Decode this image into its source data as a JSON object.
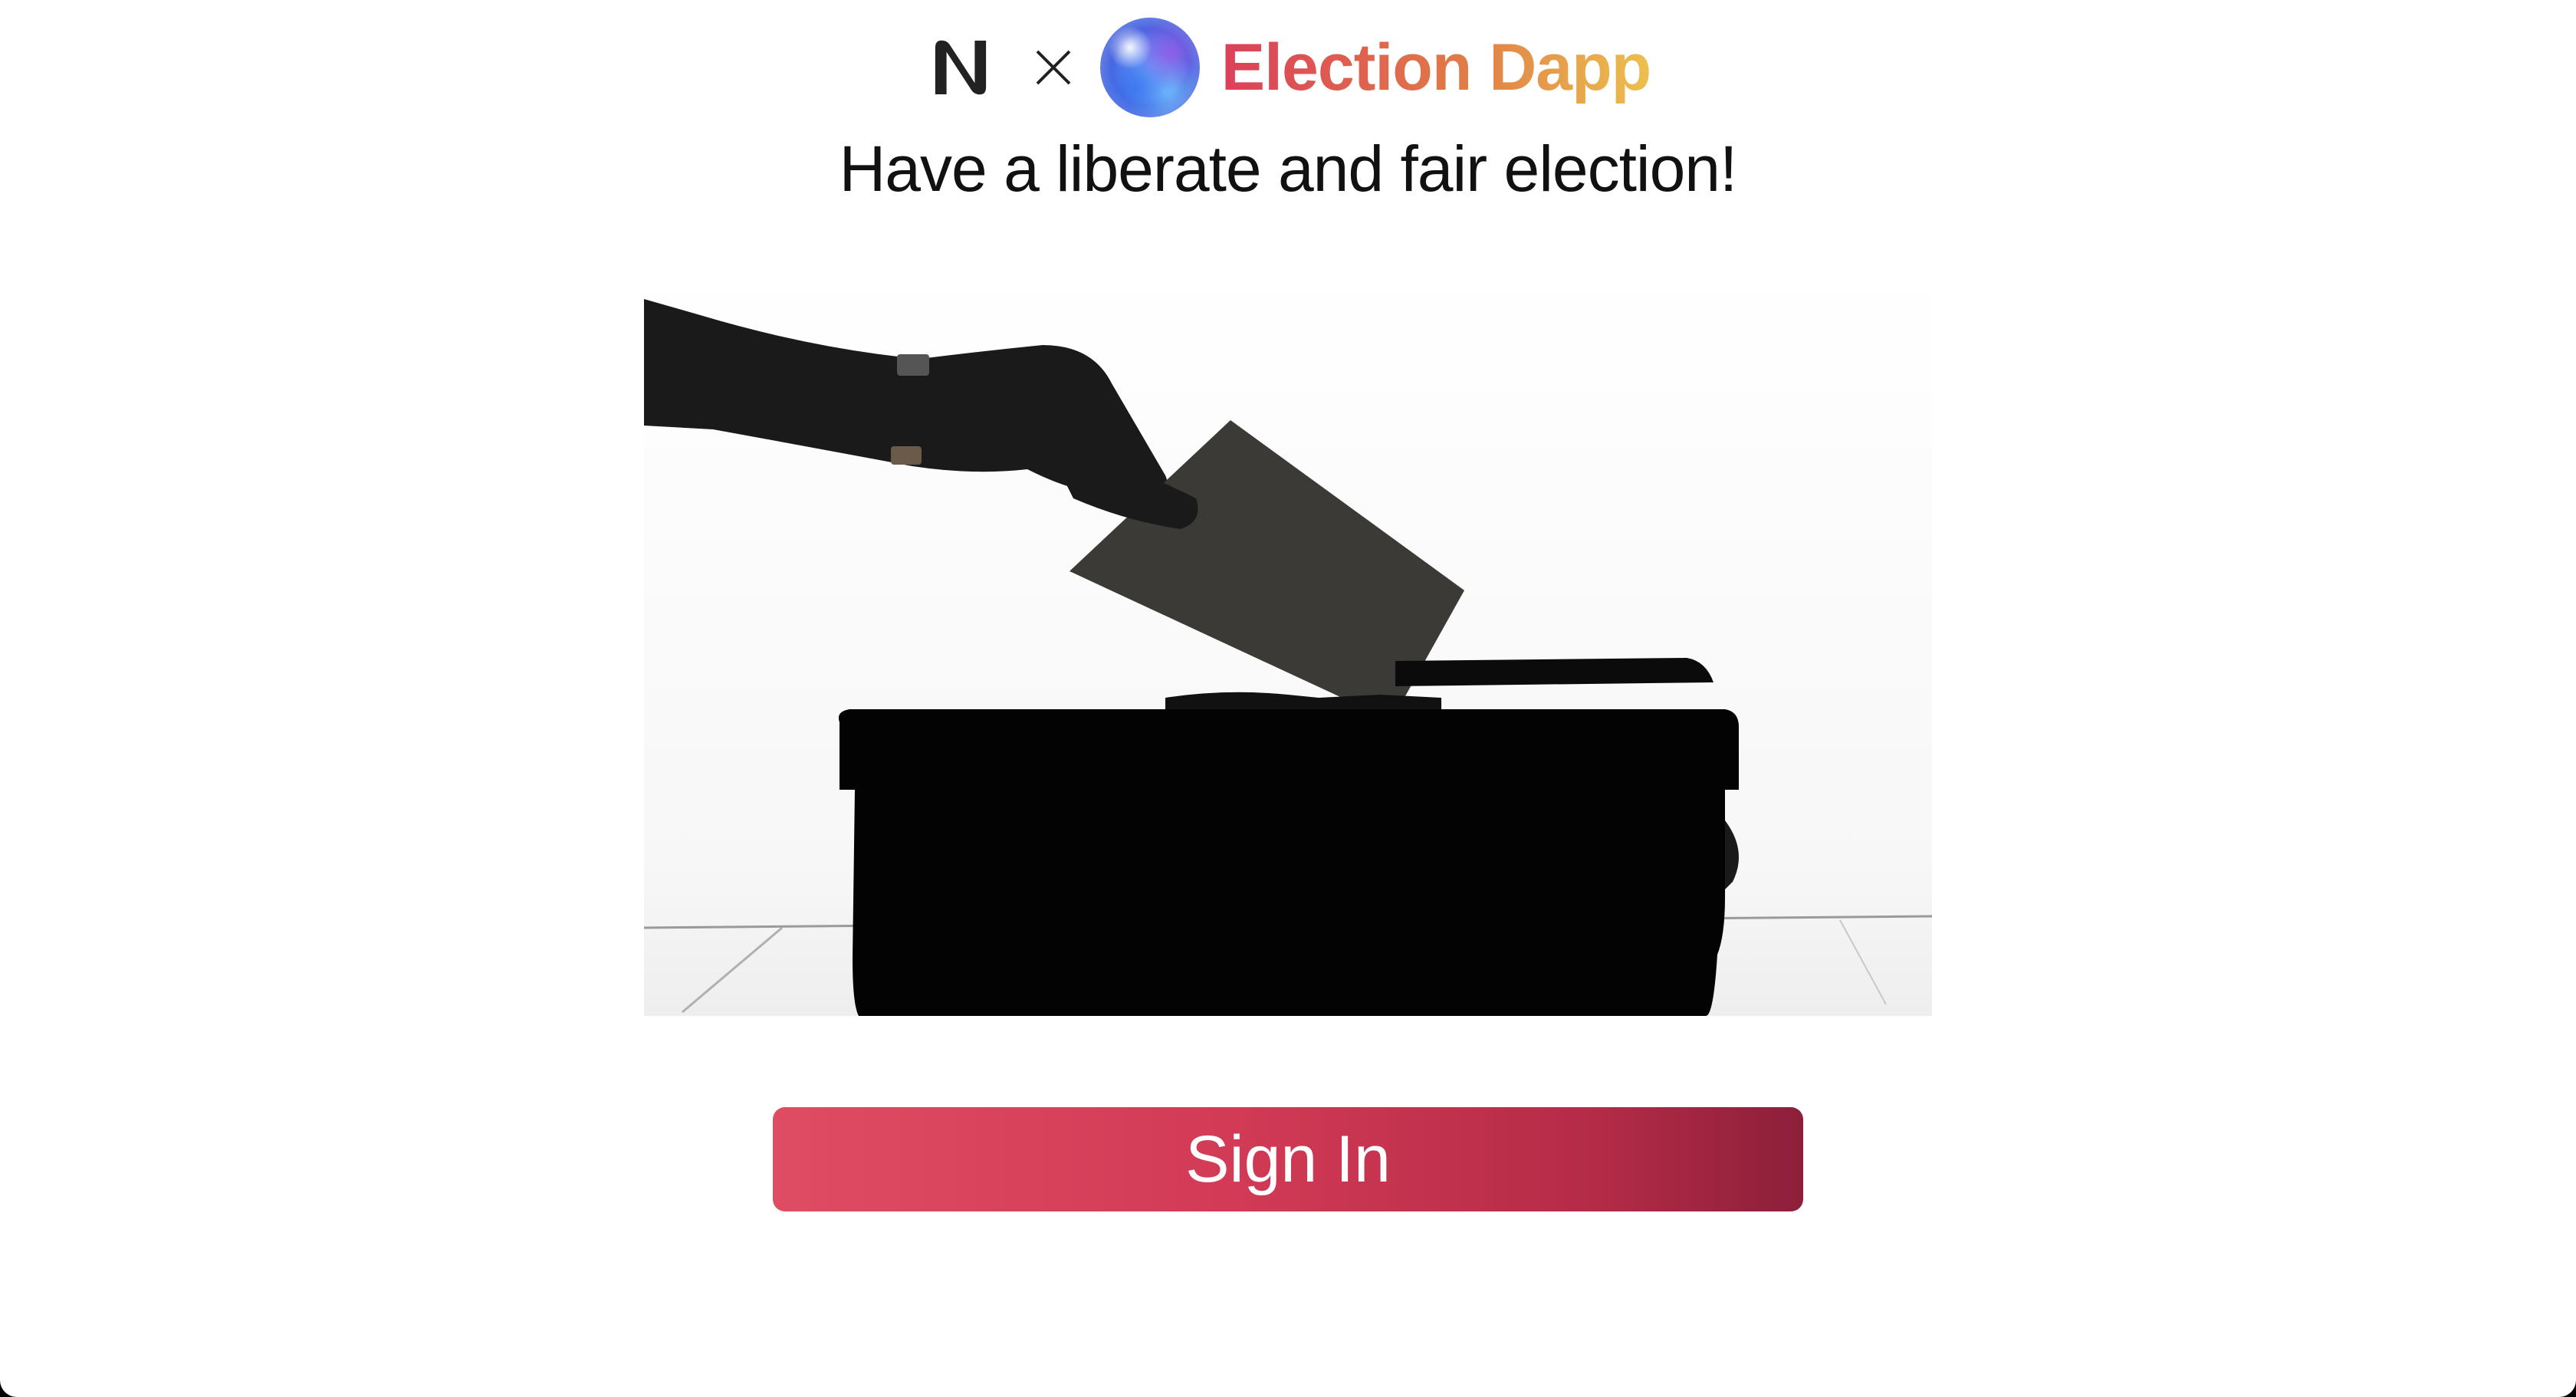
{
  "header": {
    "logo_left": "near-logo",
    "separator": "×",
    "logo_right": "election-orb",
    "title": "Election Dapp"
  },
  "main": {
    "tagline": "Have a liberate and fair election!",
    "hero_image": "ballot-box-silhouette",
    "signin_label": "Sign In"
  },
  "colors": {
    "title_gradient": [
      "#dc3f5a",
      "#e07a47",
      "#ecc04e"
    ],
    "button_gradient": [
      "#df4d62",
      "#d23a55",
      "#b42b47",
      "#8c1f3a"
    ],
    "background": "#ffffff"
  }
}
